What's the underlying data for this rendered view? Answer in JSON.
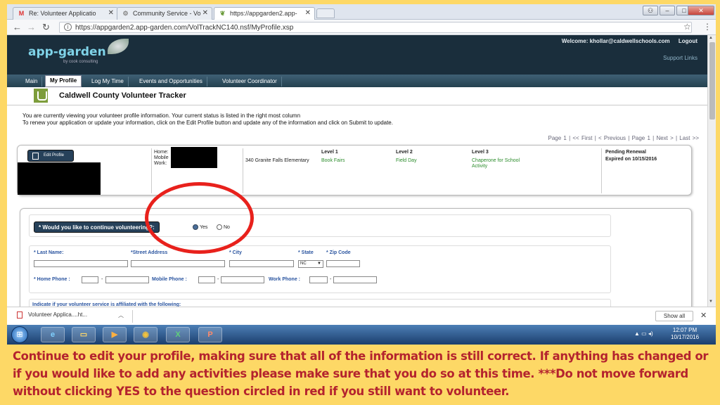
{
  "browser": {
    "tabs": [
      {
        "label": "Re: Volunteer Applicatio",
        "icon": "gmail-icon"
      },
      {
        "label": "Community Service - Vo",
        "icon": "gear-icon"
      },
      {
        "label": "https://appgarden2.app-",
        "icon": "leaf-icon"
      }
    ],
    "url": "https://appgarden2.app-garden.com/VolTrackNC140.nsf/MyProfile.xsp"
  },
  "header": {
    "logo": "app-garden",
    "logo_sub": "by cook consulting",
    "welcome": "Welcome: khollar@caldwellschools.com",
    "logout": "Logout",
    "support": "Support Links"
  },
  "nav": [
    "Main",
    "My Profile",
    "Log My Time",
    "Events and Opportunities",
    "Volunteer Coordinator"
  ],
  "page_title": "Caldwell County Volunteer Tracker",
  "intro_line1": "You are currently viewing your volunteer profile information. Your current status is listed in the right most column",
  "intro_line2": "To renew your application or update your information, click on the Edit Profile button and update any of the information and click on Submit to update.",
  "pager": "Page  1  | << First  |  < Previous  |  Page  1  |  Next >  |  Last >>",
  "profile": {
    "edit_button": "Edit Profile",
    "phone_home": "Home:",
    "phone_mobile": "Mobile",
    "phone_work": "Work:",
    "school": "340 Granite Falls Elementary",
    "level1_h": "Level 1",
    "level1_v": "Book Fairs",
    "level2_h": "Level 2",
    "level2_v": "Field Day",
    "level3_h": "Level 3",
    "level3_v1": "Chaperone for School",
    "level3_v2": "Activity",
    "status": "Pending Renewal",
    "expired": "Expired on 10/15/2016"
  },
  "form": {
    "question": "* Would you like to continue volunteering?:",
    "yes": "Yes",
    "no": "No",
    "last_name": "* Last Name:",
    "street": "*Street Address",
    "city": "* City",
    "state": "* State",
    "state_value": "NC",
    "zip": "* Zip Code",
    "home_phone": "* Home Phone :",
    "mobile_phone": "Mobile Phone :",
    "work_phone": "Work Phone :",
    "affiliation": "Indicate if your volunteer service is affiliated with the following:"
  },
  "download": {
    "file": "Volunteer Applica....ht...",
    "show_all": "Show all"
  },
  "taskbar": {
    "clock_time": "12:07 PM",
    "clock_date": "10/17/2016"
  },
  "caption": "Continue to edit your profile, making sure that all of the information is still correct.  If anything has changed or if you would like to add any activities please make sure that you do so at this time.  ***Do not move forward without clicking YES to the question circled in red if you still want to volunteer.",
  "colors": {
    "background": "#fdd866",
    "caption": "#b4232e",
    "header": "#1a2e3c",
    "circle": "#e8211c"
  }
}
